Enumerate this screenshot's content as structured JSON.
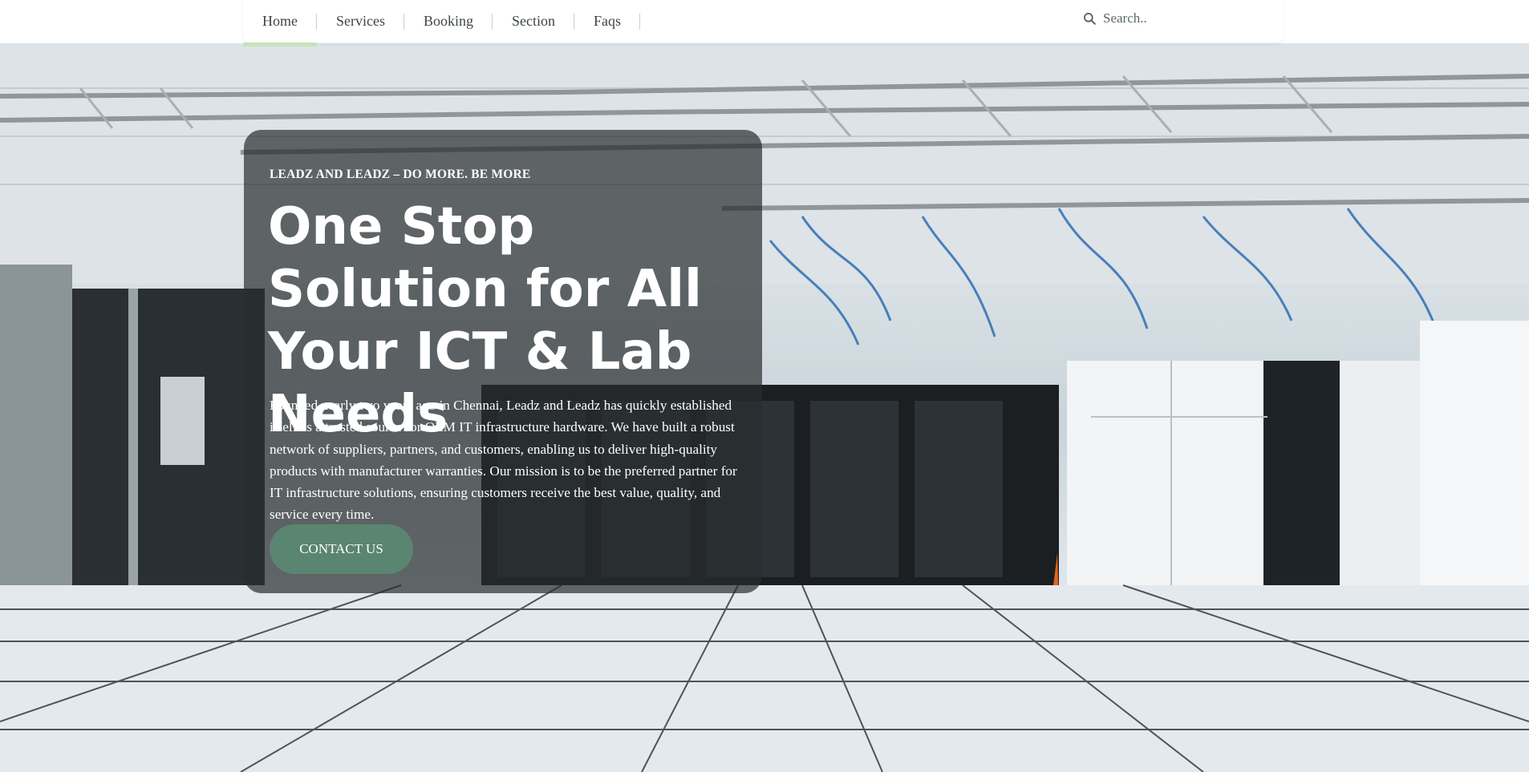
{
  "nav": {
    "items": [
      {
        "label": "Home",
        "active": true
      },
      {
        "label": "Services",
        "active": false
      },
      {
        "label": "Booking",
        "active": false
      },
      {
        "label": "Section",
        "active": false
      },
      {
        "label": "Faqs",
        "active": false
      }
    ],
    "search_placeholder": "Search..",
    "active_color": "#c7e2b8"
  },
  "hero": {
    "eyebrow": "LEADZ AND LEADZ – DO MORE. BE MORE",
    "headline": "One Stop Solution for All Your ICT & Lab Needs",
    "intro": "Founded nearly two years ago in Chennai, Leadz and Leadz has quickly established itself as a trusted source for OEM IT infrastructure hardware. We have built a robust network of suppliers, partners, and customers, enabling us to deliver high-quality products with manufacturer warranties. Our mission is to be the preferred partner for IT infrastructure solutions, ensuring customers receive the best value, quality, and service every time.",
    "cta_label": "CONTACT US",
    "cta_color": "#5a8570",
    "panel_color": "#282c2e"
  }
}
